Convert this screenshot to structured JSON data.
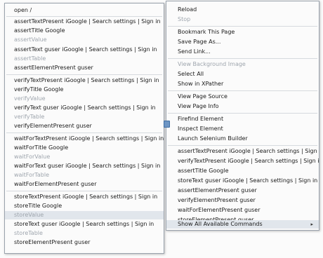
{
  "left_menu": {
    "items": [
      {
        "label": "open /",
        "disabled": false,
        "highlight": false
      },
      {
        "label": "assertTextPresent iGoogle | Search settings | Sign in",
        "disabled": false,
        "highlight": false
      },
      {
        "label": "assertTitle Google",
        "disabled": false,
        "highlight": false
      },
      {
        "label": "assertValue",
        "disabled": true,
        "highlight": false
      },
      {
        "label": "assertText guser iGoogle | Search settings | Sign in",
        "disabled": false,
        "highlight": false
      },
      {
        "label": "assertTable",
        "disabled": true,
        "highlight": false
      },
      {
        "label": "assertElementPresent guser",
        "disabled": false,
        "highlight": false
      },
      {
        "label": "verifyTextPresent iGoogle | Search settings | Sign in",
        "disabled": false,
        "highlight": false
      },
      {
        "label": "verifyTitle Google",
        "disabled": false,
        "highlight": false
      },
      {
        "label": "verifyValue",
        "disabled": true,
        "highlight": false
      },
      {
        "label": "verifyText guser iGoogle | Search settings | Sign in",
        "disabled": false,
        "highlight": false
      },
      {
        "label": "verifyTable",
        "disabled": true,
        "highlight": false
      },
      {
        "label": "verifyElementPresent guser",
        "disabled": false,
        "highlight": false
      },
      {
        "label": "waitForTextPresent iGoogle | Search settings | Sign in",
        "disabled": false,
        "highlight": false
      },
      {
        "label": "waitForTitle Google",
        "disabled": false,
        "highlight": false
      },
      {
        "label": "waitForValue",
        "disabled": true,
        "highlight": false
      },
      {
        "label": "waitForText guser iGoogle | Search settings | Sign in",
        "disabled": false,
        "highlight": false
      },
      {
        "label": "waitForTable",
        "disabled": true,
        "highlight": false
      },
      {
        "label": "waitForElementPresent guser",
        "disabled": false,
        "highlight": false
      },
      {
        "label": "storeTextPresent iGoogle | Search settings | Sign in",
        "disabled": false,
        "highlight": false
      },
      {
        "label": "storeTitle Google",
        "disabled": false,
        "highlight": false
      },
      {
        "label": "storeValue",
        "disabled": true,
        "highlight": true
      },
      {
        "label": "storeText guser iGoogle | Search settings | Sign in",
        "disabled": false,
        "highlight": false
      },
      {
        "label": "storeTable",
        "disabled": true,
        "highlight": false
      },
      {
        "label": "storeElementPresent guser",
        "disabled": false,
        "highlight": false
      }
    ]
  },
  "right_menu": {
    "items": [
      {
        "label": "Reload",
        "disabled": false,
        "highlight": false
      },
      {
        "label": "Stop",
        "disabled": true,
        "highlight": false
      },
      {
        "label": "Bookmark This Page",
        "disabled": false,
        "highlight": false
      },
      {
        "label": "Save Page As...",
        "disabled": false,
        "highlight": false
      },
      {
        "label": "Send Link...",
        "disabled": false,
        "highlight": false
      },
      {
        "label": "View Background Image",
        "disabled": true,
        "highlight": false
      },
      {
        "label": "Select All",
        "disabled": false,
        "highlight": false
      },
      {
        "label": "Show in XPather",
        "disabled": false,
        "highlight": false
      },
      {
        "label": "View Page Source",
        "disabled": false,
        "highlight": false
      },
      {
        "label": "View Page Info",
        "disabled": false,
        "highlight": false
      },
      {
        "label": "Firefind Element",
        "disabled": false,
        "highlight": false
      },
      {
        "label": "Inspect Element",
        "disabled": false,
        "highlight": false
      },
      {
        "label": "Launch Selenium Builder",
        "disabled": false,
        "highlight": false
      },
      {
        "label": "assertTextPresent iGoogle | Search settings | Sign in",
        "disabled": false,
        "highlight": false
      },
      {
        "label": "verifyTextPresent iGoogle | Search settings | Sign in",
        "disabled": false,
        "highlight": false
      },
      {
        "label": "assertTitle Google",
        "disabled": false,
        "highlight": false
      },
      {
        "label": "storeText guser iGoogle | Search settings | Sign in",
        "disabled": false,
        "highlight": false
      },
      {
        "label": "assertElementPresent guser",
        "disabled": false,
        "highlight": false
      },
      {
        "label": "verifyElementPresent guser",
        "disabled": false,
        "highlight": false
      },
      {
        "label": "waitForElementPresent guser",
        "disabled": false,
        "highlight": false
      },
      {
        "label": "storeElementPresent guser",
        "disabled": false,
        "highlight": false
      },
      {
        "label": "Show All Available Commands",
        "disabled": false,
        "highlight": true,
        "submenu_icon": "submenu-arrow-icon",
        "arrow": "▸"
      }
    ]
  },
  "colors": {
    "highlight": "#e1e6ec",
    "disabled_text": "#9ea5ad",
    "text": "#1a1a1a"
  }
}
